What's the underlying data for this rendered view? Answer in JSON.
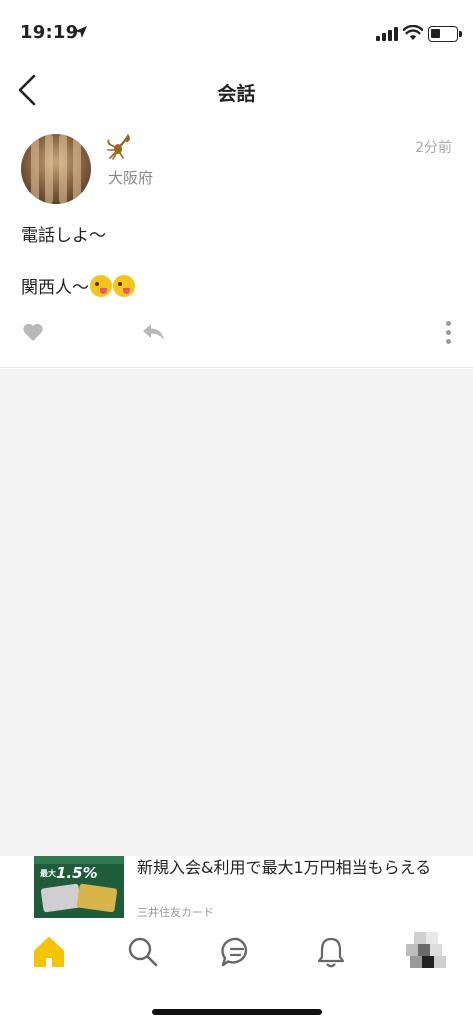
{
  "status_bar": {
    "time": "19:19",
    "icons": [
      "location-arrow-icon",
      "cellular-signal-icon",
      "wifi-icon",
      "battery-icon"
    ]
  },
  "nav": {
    "title": "会話",
    "back_icon": "chevron-left-icon"
  },
  "post": {
    "badge_icon": "scorpion-icon",
    "location": "大阪府",
    "time_ago": "2分前",
    "lines": [
      "電話しよ〜",
      "関西人〜"
    ],
    "emoji_icon": "zany-face-emoji",
    "actions": [
      "heart-icon",
      "reply-icon",
      "more-vertical-icon"
    ]
  },
  "ad": {
    "image_text_rate": "1.5%",
    "image_text_label": "最大",
    "headline": "新規入会&利用で最大1万円相当もらえる",
    "sponsor": "三井住友カード"
  },
  "tab_bar": {
    "tabs": [
      "home-icon",
      "search-icon",
      "chat-icon",
      "bell-icon",
      "profile-avatar"
    ],
    "active_color": "#f5c400",
    "inactive_color": "#666666"
  }
}
